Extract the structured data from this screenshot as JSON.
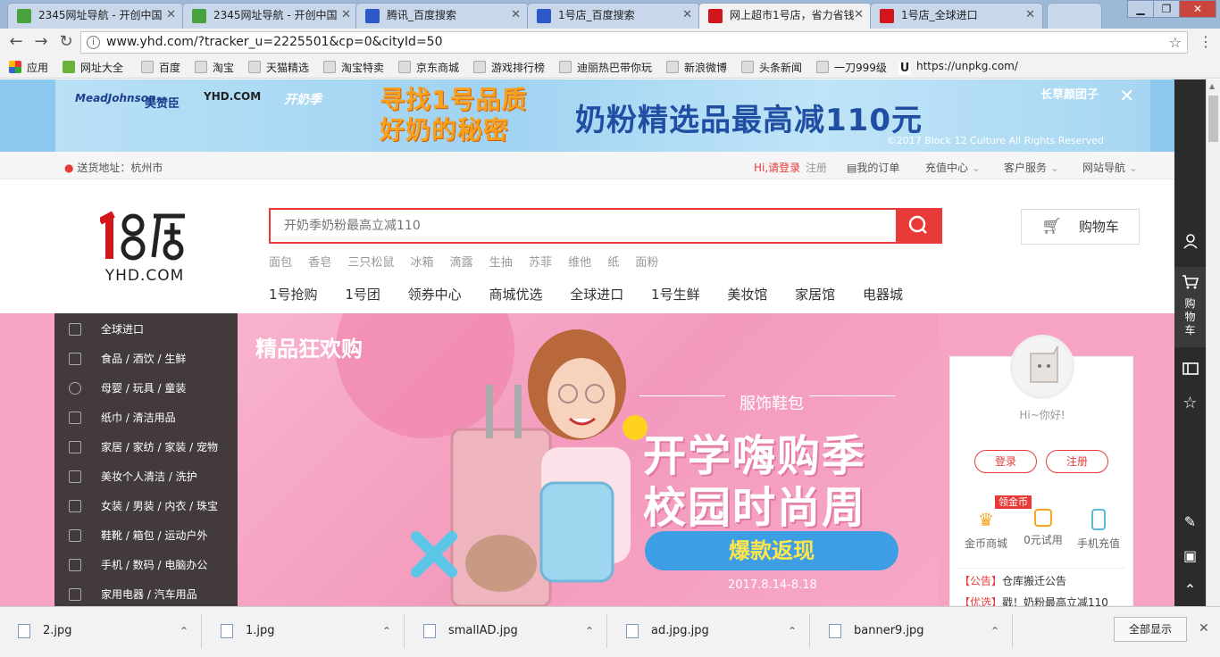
{
  "browser": {
    "tabs": [
      {
        "title": "2345网址导航 - 开创中国",
        "favicon": "2345-icon",
        "active": false
      },
      {
        "title": "2345网址导航 - 开创中国",
        "favicon": "2345-icon",
        "active": false
      },
      {
        "title": "腾讯_百度搜索",
        "favicon": "baidu-paw-icon",
        "active": false
      },
      {
        "title": "1号店_百度搜索",
        "favicon": "baidu-paw-icon",
        "active": false
      },
      {
        "title": "网上超市1号店，省力省钱",
        "favicon": "yhd-icon",
        "active": true
      },
      {
        "title": "1号店_全球进口",
        "favicon": "yhd-icon",
        "active": false
      }
    ],
    "url": "www.yhd.com/?tracker_u=2225501&cp=0&cityId=50",
    "bookmarks": [
      "应用",
      "网址大全",
      "百度",
      "淘宝",
      "天猫精选",
      "淘宝特卖",
      "京东商城",
      "游戏排行榜",
      "迪丽热巴带你玩",
      "新浪微博",
      "头条新闻",
      "一刀999级",
      "https://unpkg.com/"
    ]
  },
  "banner": {
    "brand_left": "MeadJohnson",
    "brand_left_cn": "美赞臣",
    "brand_yhd": "YHD.COM",
    "brand_kai": "开奶季",
    "slogan_line1": "寻找1号品质",
    "slogan_line2": "好奶的秘密",
    "headline": "奶粉精选品最高减110元",
    "brand_right": "长草颜团子",
    "copyright": "©2017 Block 12 Culture All Rights Reserved",
    "close": "✕"
  },
  "infobar": {
    "location_label": "送货地址：杭州市",
    "login": "Hi,请登录",
    "register": "注册",
    "orders": "我的订单",
    "recharge": "充值中心",
    "service": "客户服务",
    "sitenav": "网站导航"
  },
  "header": {
    "logo_text": "YHD.COM",
    "search_placeholder": "开奶季奶粉最高立减110",
    "hotwords": [
      "面包",
      "香皂",
      "三只松鼠",
      "冰箱",
      "滴露",
      "生抽",
      "苏菲",
      "维他",
      "纸",
      "面粉"
    ],
    "cart_label": "购物车",
    "nav": [
      "1号抢购",
      "1号团",
      "领券中心",
      "商城优选",
      "全球进口",
      "1号生鲜",
      "美妆馆",
      "家居馆",
      "电器城"
    ]
  },
  "categories": [
    {
      "label": "全球进口",
      "icon": "bottle-icon"
    },
    {
      "label": "食品 / 酒饮 / 生鲜",
      "icon": "cutlery-icon"
    },
    {
      "label": "母婴 / 玩具 / 童装",
      "icon": "baby-icon"
    },
    {
      "label": "纸巾 / 清洁用品",
      "icon": "spray-icon"
    },
    {
      "label": "家居 / 家纺 / 家装 / 宠物",
      "icon": "home-icon"
    },
    {
      "label": "美妆个人清洁 / 洗护",
      "icon": "lipstick-icon"
    },
    {
      "label": "女装 / 男装 / 内衣 / 珠宝",
      "icon": "dress-icon"
    },
    {
      "label": "鞋靴 / 箱包 / 运动户外",
      "icon": "bag-icon"
    },
    {
      "label": "手机 / 数码 / 电脑办公",
      "icon": "phone-icon"
    },
    {
      "label": "家用电器 / 汽车用品",
      "icon": "tv-icon"
    }
  ],
  "hero": {
    "tag": "精品狂欢购",
    "subtitle": "服饰鞋包",
    "line1": "开学嗨购季",
    "line2": "校园时尚周",
    "button": "爆款返现",
    "date": "2017.8.14-8.18"
  },
  "user_panel": {
    "greeting": "Hi~你好!",
    "login": "登录",
    "register": "注册",
    "badge": "领金币",
    "shortcuts": [
      {
        "label": "金币商城",
        "icon": "crown-icon",
        "color": "#f5a623"
      },
      {
        "label": "0元试用",
        "icon": "shopping-bag-icon",
        "color": "#f5a623"
      },
      {
        "label": "手机充值",
        "icon": "mobile-icon",
        "color": "#5bbbd6"
      }
    ],
    "notices": [
      {
        "tag": "【公告】",
        "text": "仓库搬迁公告"
      },
      {
        "tag": "【优选】",
        "text": "戳！奶粉最高立减110"
      }
    ]
  },
  "sidebar": {
    "cart_label": "购物车"
  },
  "downloads": {
    "items": [
      "2.jpg",
      "1.jpg",
      "smallAD.jpg",
      "ad.jpg.jpg",
      "banner9.jpg"
    ],
    "show_all": "全部显示"
  }
}
